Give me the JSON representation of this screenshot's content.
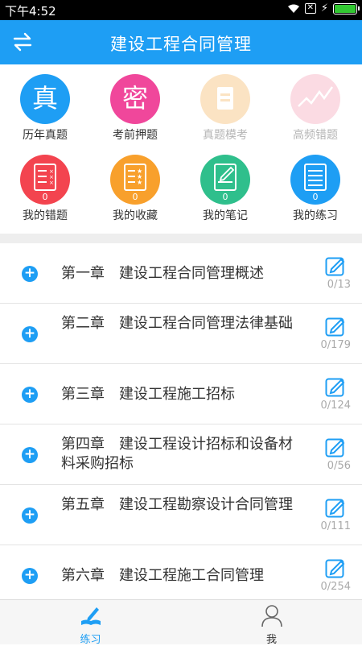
{
  "status": {
    "time": "下午4:52"
  },
  "header": {
    "title": "建设工程合同管理"
  },
  "grid": [
    {
      "label": "历年真题",
      "glyph": "真",
      "color": "#1e9ef4",
      "dim": false,
      "icon": "zhen-icon"
    },
    {
      "label": "考前押题",
      "glyph": "密",
      "color": "#f0479b",
      "dim": false,
      "icon": "mi-icon"
    },
    {
      "label": "真题模考",
      "glyph": "",
      "color": "#fbe3c3",
      "dim": true,
      "icon": "exam-paper-icon"
    },
    {
      "label": "高频错题",
      "glyph": "",
      "color": "#fbdbe3",
      "dim": true,
      "icon": "trend-chart-icon"
    },
    {
      "label": "我的错题",
      "count": "0",
      "color": "#f3444f",
      "icon": "wrong-list-icon"
    },
    {
      "label": "我的收藏",
      "count": "0",
      "color": "#f8a02c",
      "icon": "star-list-icon"
    },
    {
      "label": "我的笔记",
      "count": "0",
      "color": "#2fbf8c",
      "icon": "note-icon"
    },
    {
      "label": "我的练习",
      "count": "0",
      "color": "#1e9ef4",
      "icon": "practice-book-icon"
    }
  ],
  "chapters": [
    {
      "chapter": "第一章",
      "title": "建设工程合同管理概述",
      "count": "0/13"
    },
    {
      "chapter": "第二章",
      "title": "建设工程合同管理法律基础",
      "count": "0/179"
    },
    {
      "chapter": "第三章",
      "title": "建设工程施工招标",
      "count": "0/124"
    },
    {
      "chapter": "第四章",
      "title": "建设工程设计招标和设备材料采购招标",
      "count": "0/56"
    },
    {
      "chapter": "第五章",
      "title": "建设工程勘察设计合同管理",
      "count": "0/111"
    },
    {
      "chapter": "第六章",
      "title": "建设工程施工合同管理",
      "count": "0/254"
    }
  ],
  "tabs": [
    {
      "label": "练习",
      "active": true
    },
    {
      "label": "我",
      "active": false
    }
  ],
  "colors": {
    "accent": "#1e9ef4",
    "inactive": "#555555"
  }
}
